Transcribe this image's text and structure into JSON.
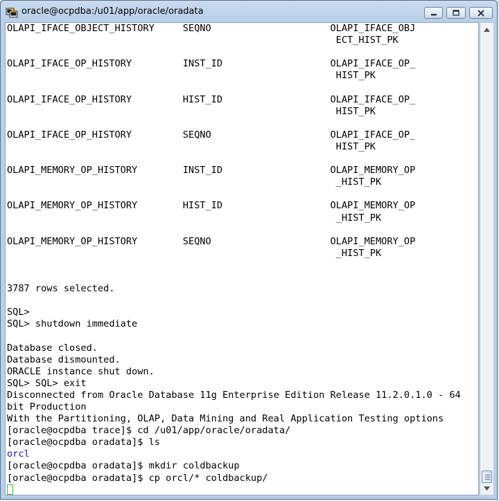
{
  "window": {
    "title": "oracle@ocpdba:/u01/app/oracle/oradata",
    "icons": {
      "app": "putty-icon",
      "minimize": "minimize-icon",
      "maximize": "maximize-icon",
      "close": "close-icon"
    }
  },
  "terminal": {
    "lines": [
      {
        "text": "OLAPI_IFACE_OBJECT_HISTORY     SEQNO                     OLAPI_IFACE_OBJ"
      },
      {
        "text": "                                                          ECT_HIST_PK"
      },
      {
        "text": ""
      },
      {
        "text": "OLAPI_IFACE_OP_HISTORY         INST_ID                   OLAPI_IFACE_OP_"
      },
      {
        "text": "                                                          HIST_PK"
      },
      {
        "text": ""
      },
      {
        "text": "OLAPI_IFACE_OP_HISTORY         HIST_ID                   OLAPI_IFACE_OP_"
      },
      {
        "text": "                                                          HIST_PK"
      },
      {
        "text": ""
      },
      {
        "text": "OLAPI_IFACE_OP_HISTORY         SEQNO                     OLAPI_IFACE_OP_"
      },
      {
        "text": "                                                          HIST_PK"
      },
      {
        "text": ""
      },
      {
        "text": "OLAPI_MEMORY_OP_HISTORY        INST_ID                   OLAPI_MEMORY_OP"
      },
      {
        "text": "                                                          _HIST_PK"
      },
      {
        "text": ""
      },
      {
        "text": "OLAPI_MEMORY_OP_HISTORY        HIST_ID                   OLAPI_MEMORY_OP"
      },
      {
        "text": "                                                          _HIST_PK"
      },
      {
        "text": ""
      },
      {
        "text": "OLAPI_MEMORY_OP_HISTORY        SEQNO                     OLAPI_MEMORY_OP"
      },
      {
        "text": "                                                          _HIST_PK"
      },
      {
        "text": ""
      },
      {
        "text": ""
      },
      {
        "text": "3787 rows selected."
      },
      {
        "text": ""
      },
      {
        "text": "SQL>"
      },
      {
        "text": "SQL> shutdown immediate"
      },
      {
        "text": ""
      },
      {
        "text": "Database closed."
      },
      {
        "text": "Database dismounted."
      },
      {
        "text": "ORACLE instance shut down."
      },
      {
        "text": "SQL> SQL> exit"
      },
      {
        "text": "Disconnected from Oracle Database 11g Enterprise Edition Release 11.2.0.1.0 - 64"
      },
      {
        "text": "bit Production"
      },
      {
        "text": "With the Partitioning, OLAP, Data Mining and Real Application Testing options"
      },
      {
        "text": "[oracle@ocpdba trace]$ cd /u01/app/oracle/oradata/"
      },
      {
        "text": "[oracle@ocpdba oradata]$ ls"
      },
      {
        "text": "orcl",
        "color": "blue"
      },
      {
        "text": "[oracle@ocpdba oradata]$ mkdir coldbackup"
      },
      {
        "text": "[oracle@ocpdba oradata]$ cp orcl/* coldbackup/"
      }
    ],
    "cursor_color": "#2ebd2e",
    "directory_color": "#1a1ab0"
  },
  "scrollbar": {
    "up_icon": "scroll-up-arrow-icon",
    "down_icon": "scroll-down-arrow-icon"
  }
}
